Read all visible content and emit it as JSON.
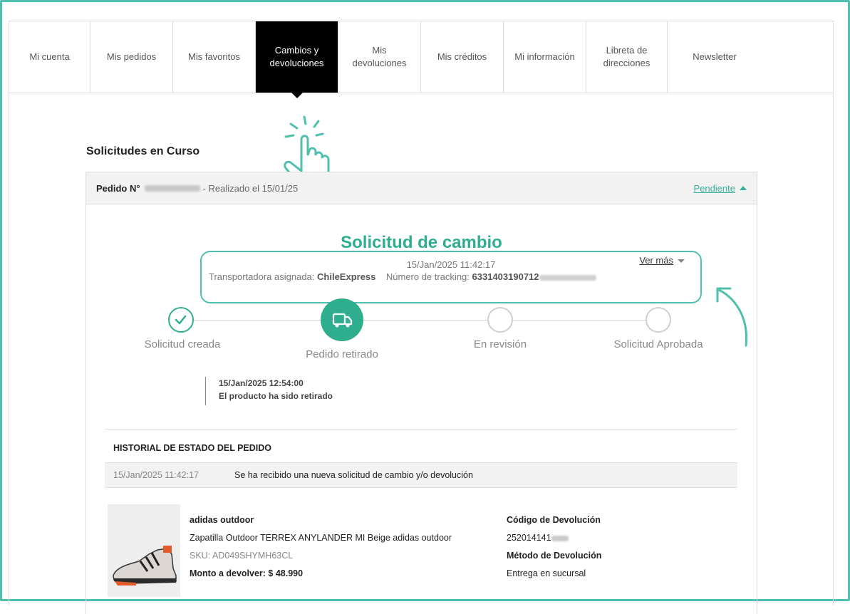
{
  "tabs": [
    {
      "label": "Mi cuenta",
      "active": false
    },
    {
      "label": "Mis pedidos",
      "active": false
    },
    {
      "label": "Mis favoritos",
      "active": false
    },
    {
      "label": "Cambios y devoluciones",
      "active": true
    },
    {
      "label": "Mis devoluciones",
      "active": false
    },
    {
      "label": "Mis créditos",
      "active": false
    },
    {
      "label": "Mi información",
      "active": false
    },
    {
      "label": "Libreta de direcciones",
      "active": false
    },
    {
      "label": "Newsletter",
      "active": false
    }
  ],
  "section_title": "Solicitudes en Curso",
  "order": {
    "label": "Pedido N°",
    "date_text": "- Realizado el 15/01/25",
    "status": "Pendiente"
  },
  "request": {
    "title": "Solicitud de cambio",
    "datetime": "15/Jan/2025 11:42:17",
    "ver_mas": "Ver más",
    "carrier_label": "Transportadora asignada:",
    "carrier": "ChileExpress",
    "tracking_label": "Número de tracking:",
    "tracking": "6331403190712"
  },
  "steps": [
    {
      "label": "Solicitud creada",
      "state": "done"
    },
    {
      "label": "Pedido retirado",
      "state": "active"
    },
    {
      "label": "En revisión",
      "state": "pending"
    },
    {
      "label": "Solicitud Aprobada",
      "state": "pending"
    }
  ],
  "event": {
    "datetime": "15/Jan/2025 12:54:00",
    "message": "El producto ha sido retirado"
  },
  "history": {
    "title": "HISTORIAL DE ESTADO DEL PEDIDO",
    "rows": [
      {
        "date": "15/Jan/2025 11:42:17",
        "message": "Se ha recibido una nueva solicitud de cambio y/o devolución"
      }
    ]
  },
  "product": {
    "brand": "adidas outdoor",
    "name": "Zapatilla Outdoor TERREX ANYLANDER MI Beige adidas outdoor",
    "sku": "SKU: AD049SHYMH63CL",
    "amount_label": "Monto a devolver: $ 48.990"
  },
  "return_info": {
    "code_label": "Código de Devolución",
    "code": "252014141",
    "method_label": "Método de Devolución",
    "method": "Entrega en sucursal"
  },
  "colors": {
    "accent": "#2fae8f",
    "frame": "#4fbfae"
  }
}
